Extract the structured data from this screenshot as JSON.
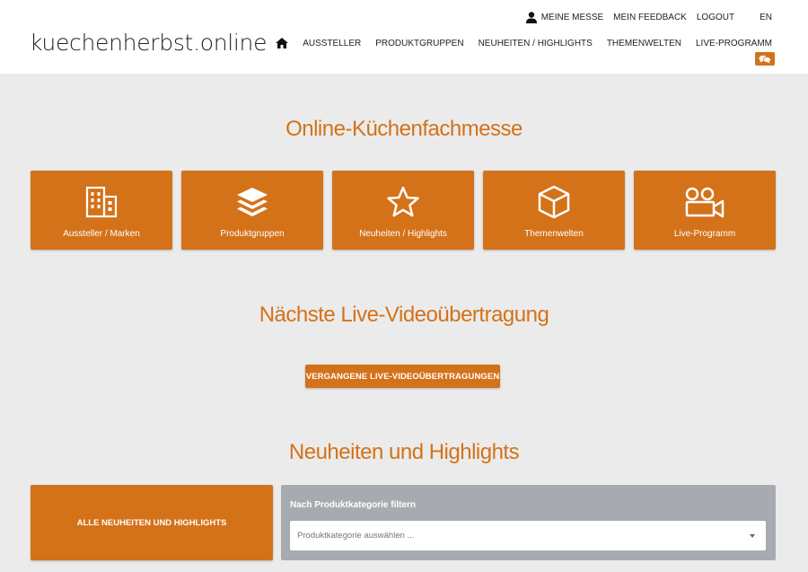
{
  "header": {
    "logo": "kuechenherbst.online",
    "topnav": {
      "meine_messe": "MEINE MESSE",
      "feedback": "MEIN FEEDBACK",
      "logout": "LOGOUT",
      "lang": "EN"
    },
    "mainnav": [
      {
        "label": "AUSSTELLER"
      },
      {
        "label": "PRODUKTGRUPPEN"
      },
      {
        "label": "NEUHEITEN / HIGHLIGHTS"
      },
      {
        "label": "THEMENWELTEN"
      },
      {
        "label": "LIVE-PROGRAMM"
      }
    ]
  },
  "sections": {
    "fair_title": "Online-Küchenfachmesse",
    "live_title": "Nächste Live-Videoübertragung",
    "highlights_title": "Neuheiten und Highlights"
  },
  "tiles": [
    {
      "label": "Aussteller / Marken",
      "icon": "building-icon"
    },
    {
      "label": "Produktgruppen",
      "icon": "layers-icon"
    },
    {
      "label": "Neuheiten / Highlights",
      "icon": "star-icon"
    },
    {
      "label": "Themenwelten",
      "icon": "cube-icon"
    },
    {
      "label": "Live-Programm",
      "icon": "video-camera-icon"
    }
  ],
  "live": {
    "past_button": "VERGANGENE LIVE-VIDEOÜBERTRAGUNGEN"
  },
  "highlights": {
    "all_button": "ALLE NEUHEITEN UND HIGHLIGHTS",
    "filter_label": "Nach Produktkategorie filtern",
    "filter_placeholder": "Produktkategorie auswählen ..."
  },
  "colors": {
    "accent": "#d4721a",
    "background": "#ebebeb",
    "filter_bg": "#a7abb0"
  }
}
